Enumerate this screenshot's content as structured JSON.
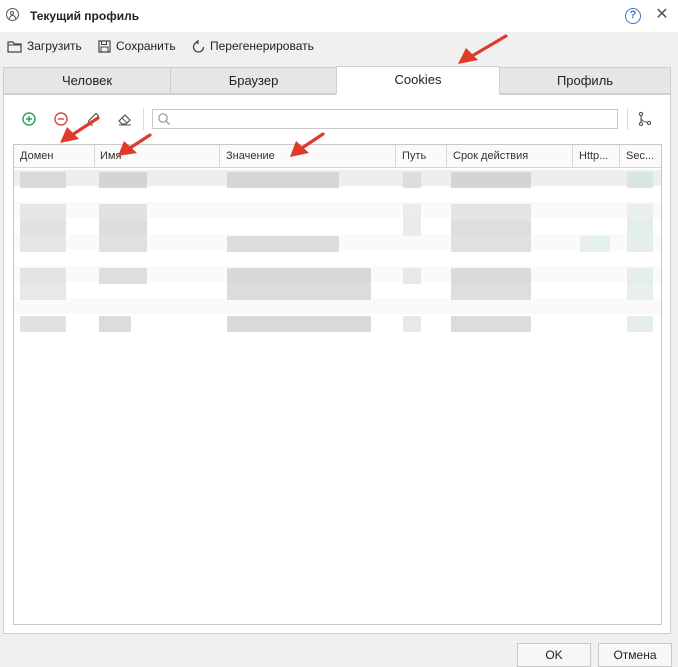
{
  "window": {
    "title": "Текущий профиль",
    "help_icon": "?",
    "close_icon": "✕"
  },
  "toolbar": {
    "load_label": "Загрузить",
    "save_label": "Сохранить",
    "regenerate_label": "Перегенерировать"
  },
  "tabs": [
    {
      "label": "Человек",
      "active": false
    },
    {
      "label": "Браузер",
      "active": false
    },
    {
      "label": "Cookies",
      "active": true
    },
    {
      "label": "Профиль",
      "active": false
    }
  ],
  "cookies_toolbar": {
    "icons": [
      "add-icon",
      "remove-icon",
      "edit-icon",
      "eraser-icon",
      "search-icon",
      "branch-icon"
    ],
    "search_value": ""
  },
  "grid": {
    "columns": [
      "Домен",
      "Имя",
      "Значение",
      "Путь",
      "Срок действия",
      "Http...",
      "Sec..."
    ]
  },
  "footer": {
    "ok_label": "OK",
    "cancel_label": "Отмена"
  },
  "colors": {
    "accent_blue": "#3a78c8",
    "add_green": "#2e9e5b",
    "remove_red": "#d64545",
    "annotation_red": "#e03a2a"
  }
}
